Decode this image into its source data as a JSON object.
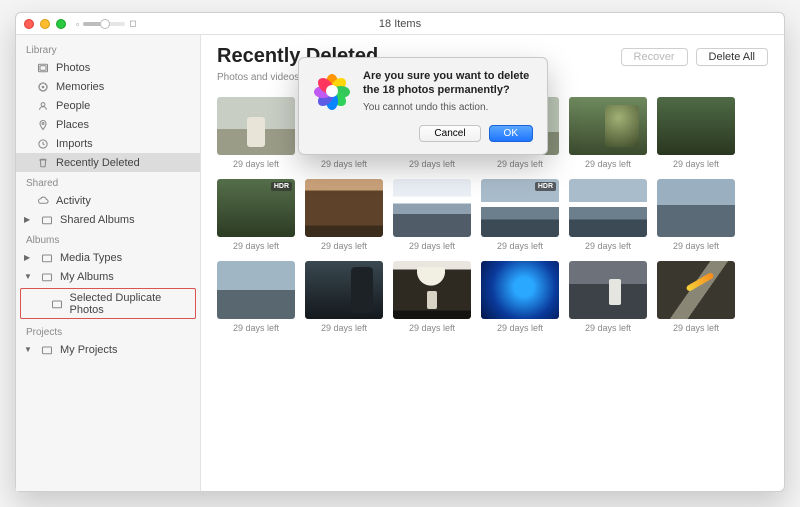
{
  "window": {
    "title": "18 Items"
  },
  "sidebar": {
    "sections": [
      {
        "header": "Library",
        "items": [
          {
            "label": "Photos",
            "icon": "photos"
          },
          {
            "label": "Memories",
            "icon": "memories"
          },
          {
            "label": "People",
            "icon": "people"
          },
          {
            "label": "Places",
            "icon": "places"
          },
          {
            "label": "Imports",
            "icon": "imports"
          },
          {
            "label": "Recently Deleted",
            "icon": "trash",
            "selected": true
          }
        ]
      },
      {
        "header": "Shared",
        "items": [
          {
            "label": "Activity",
            "icon": "cloud"
          },
          {
            "label": "Shared Albums",
            "icon": "album",
            "hasDisclosure": true
          }
        ]
      },
      {
        "header": "Albums",
        "items": [
          {
            "label": "Media Types",
            "icon": "album",
            "hasDisclosure": true
          },
          {
            "label": "My Albums",
            "icon": "album",
            "hasDisclosure": true,
            "expanded": true,
            "children": [
              {
                "label": "Selected Duplicate Photos",
                "icon": "album",
                "highlight": true
              }
            ]
          }
        ]
      },
      {
        "header": "Projects",
        "items": [
          {
            "label": "My Projects",
            "icon": "album",
            "hasDisclosure": true,
            "expanded": true
          }
        ]
      }
    ]
  },
  "page": {
    "title": "Recently Deleted",
    "subtitle": "Photos and videos shown here will be permanently deleted.",
    "recover": "Recover",
    "deleteAll": "Delete All"
  },
  "thumbs": [
    {
      "caption": "29 days left",
      "hdr": false
    },
    {
      "caption": "29 days left",
      "hdr": false
    },
    {
      "caption": "29 days left",
      "hdr": false
    },
    {
      "caption": "29 days left",
      "hdr": false
    },
    {
      "caption": "29 days left",
      "hdr": false
    },
    {
      "caption": "29 days left",
      "hdr": false
    },
    {
      "caption": "29 days left",
      "hdr": true
    },
    {
      "caption": "29 days left",
      "hdr": false
    },
    {
      "caption": "29 days left",
      "hdr": false
    },
    {
      "caption": "29 days left",
      "hdr": true
    },
    {
      "caption": "29 days left",
      "hdr": false
    },
    {
      "caption": "29 days left",
      "hdr": false
    },
    {
      "caption": "29 days left",
      "hdr": false
    },
    {
      "caption": "29 days left",
      "hdr": false
    },
    {
      "caption": "29 days left",
      "hdr": false
    },
    {
      "caption": "29 days left",
      "hdr": false
    },
    {
      "caption": "29 days left",
      "hdr": false
    },
    {
      "caption": "29 days left",
      "hdr": false
    }
  ],
  "dialog": {
    "title": "Are you sure you want to delete the 18 photos permanently?",
    "message": "You cannot undo this action.",
    "cancel": "Cancel",
    "ok": "OK"
  },
  "hdrBadge": "HDR"
}
